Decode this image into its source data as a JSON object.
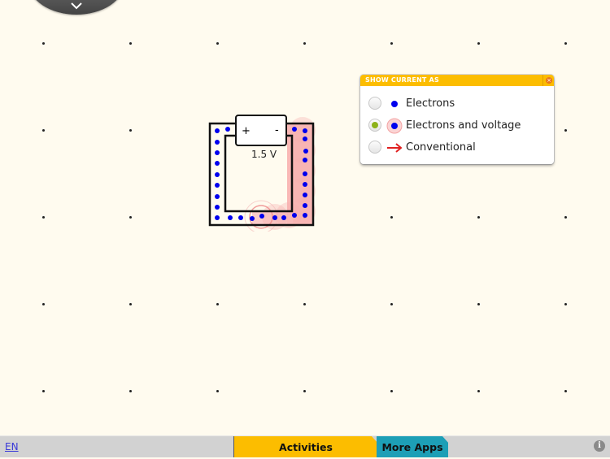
{
  "menu": {
    "toggle_icon": "chevron-down-icon"
  },
  "circuit": {
    "battery": {
      "positive_label": "+",
      "negative_label": "-",
      "voltage_label": "1.5 V"
    },
    "current_display": "electrons-and-voltage",
    "colors": {
      "wire_outline": "#111111",
      "electron": "#0000ee",
      "voltage_glow": "#f48a8a"
    }
  },
  "show_current_panel": {
    "title": "SHOW CURRENT AS",
    "close_icon": "close-icon",
    "options": [
      {
        "label": "Electrons",
        "icon": "electron-dot-icon",
        "selected": false
      },
      {
        "label": "Electrons and voltage",
        "icon": "electron-voltage-dot-icon",
        "selected": true
      },
      {
        "label": "Conventional",
        "icon": "red-arrow-icon",
        "selected": false
      }
    ],
    "colors": {
      "header": "#fcbd00",
      "selected_radio": "#8db21a"
    }
  },
  "bottom_bar": {
    "language": "EN",
    "tabs": [
      {
        "label": "Activities",
        "color": "#fcbd00"
      },
      {
        "label": "More Apps",
        "color": "#1d9fb6"
      }
    ],
    "info_icon": "i"
  }
}
